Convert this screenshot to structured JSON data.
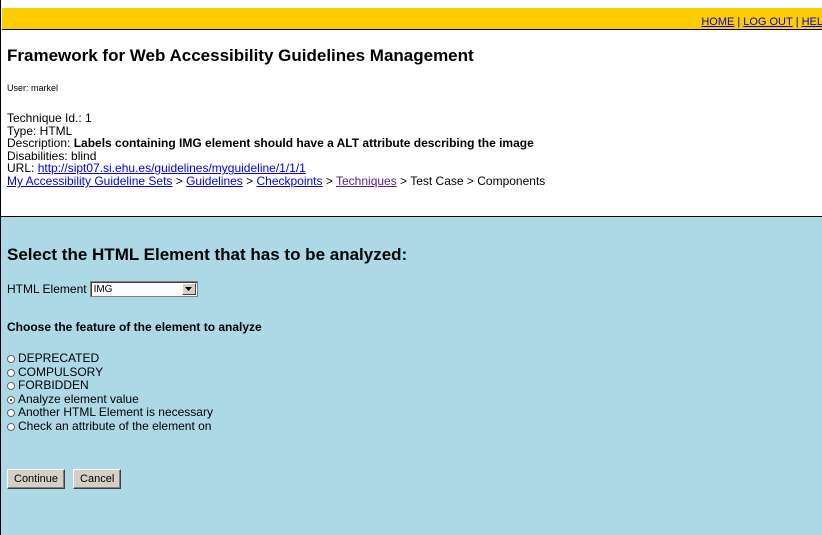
{
  "topnav": {
    "home": "HOME",
    "logout": "LOG OUT",
    "help": "HEL",
    "sep": "|"
  },
  "header": {
    "title": "Framework for Web Accessibility Guidelines Management",
    "user": "User: markel",
    "technique_id": "Technique Id.: 1",
    "type": "Type: HTML",
    "description_label": "Description: ",
    "description_text": "Labels containing IMG element should have a ALT attribute describing the image",
    "disabilities": "Disabilities: blind",
    "url_label": "URL: ",
    "url": "http://sipt07.si.ehu.es/guidelines/myguideline/1/1/1",
    "breadcrumb": {
      "sets": "My Accessibility Guideline Sets",
      "guidelines": "Guidelines",
      "checkpoints": "Checkpoints",
      "techniques": "Techniques",
      "test_case": "Test Case",
      "components": "Components",
      "sep": " > "
    }
  },
  "panel": {
    "heading": "Select the HTML Element that has to be analyzed:",
    "element_label": "HTML Element",
    "element_value": "IMG",
    "feature_heading": "Choose the feature of the element to analyze",
    "options": [
      "DEPRECATED",
      "COMPULSORY",
      "FORBIDDEN",
      "Analyze element value",
      "Another HTML Element is necessary",
      "Check an attribute of the element on"
    ],
    "selected_option": "Analyze element value",
    "continue_label": "Continue",
    "cancel_label": "Cancel"
  },
  "colors": {
    "topbar": "#ffcc00",
    "panel": "#add8e6",
    "link": "#0000ee",
    "visited_link": "#551a8b"
  }
}
